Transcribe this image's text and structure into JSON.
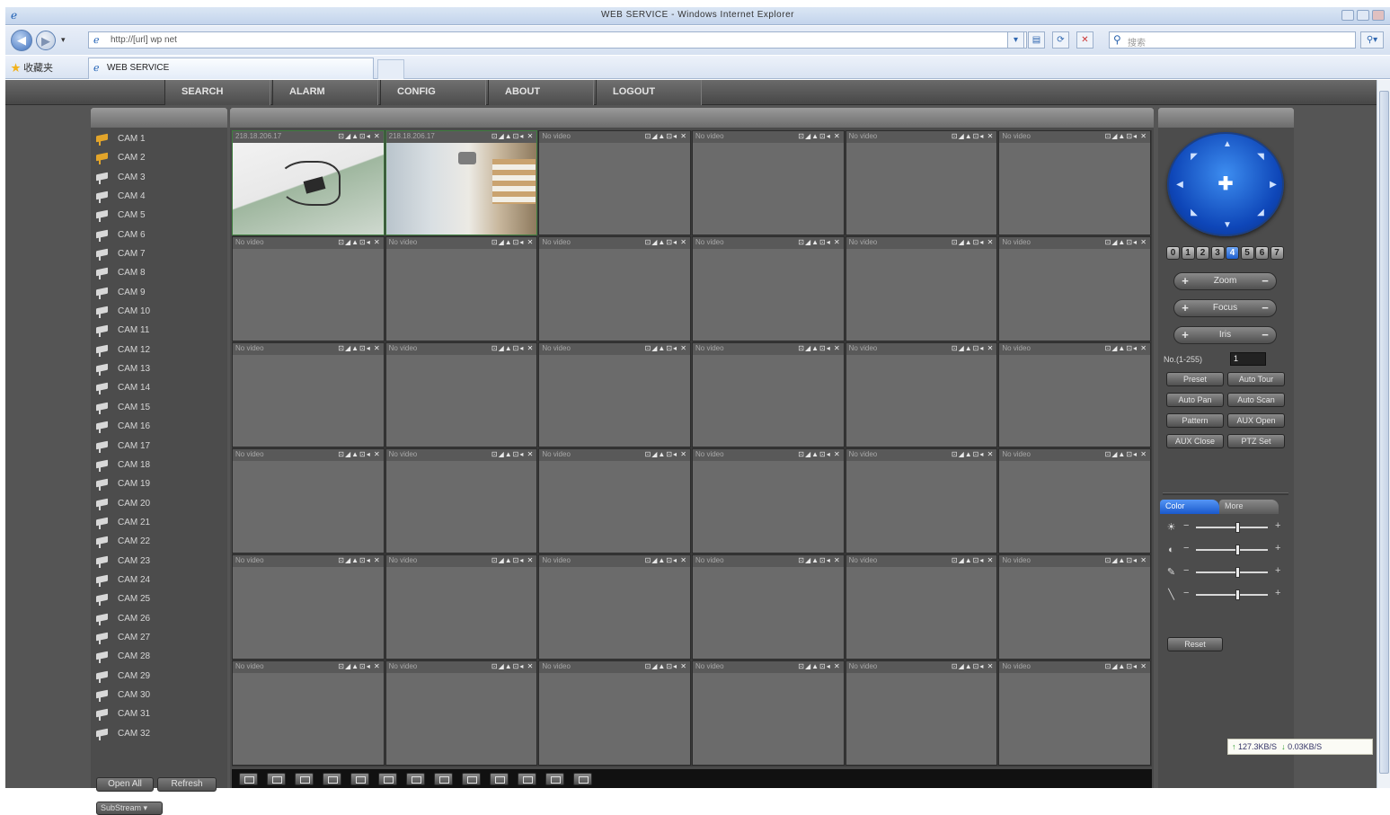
{
  "browser": {
    "title": "WEB SERVICE - Windows Internet Explorer",
    "address": "http://[url] wp net",
    "search_placeholder": "搜索",
    "favorites_label": "收藏夹",
    "tab_label": "WEB SERVICE"
  },
  "menu": [
    "SEARCH",
    "ALARM",
    "CONFIG",
    "ABOUT",
    "LOGOUT"
  ],
  "cameras": [
    "CAM 1",
    "CAM 2",
    "CAM 3",
    "CAM 4",
    "CAM 5",
    "CAM 6",
    "CAM 7",
    "CAM 8",
    "CAM 9",
    "CAM 10",
    "CAM 11",
    "CAM 12",
    "CAM 13",
    "CAM 14",
    "CAM 15",
    "CAM 16",
    "CAM 17",
    "CAM 18",
    "CAM 19",
    "CAM 20",
    "CAM 21",
    "CAM 22",
    "CAM 23",
    "CAM 24",
    "CAM 25",
    "CAM 26",
    "CAM 27",
    "CAM 28",
    "CAM 29",
    "CAM 30",
    "CAM 31",
    "CAM 32"
  ],
  "active_cameras": [
    1,
    2
  ],
  "left_buttons": {
    "open_all": "Open All",
    "refresh": "Refresh",
    "stream": "SubStream"
  },
  "video": {
    "live_labels": [
      "218.18.206.17",
      "218.18.206.17"
    ],
    "no_video": "No video",
    "controls_glyphs": "⊡◢▲⊡◂ ✕"
  },
  "ptz": {
    "speeds": [
      "0",
      "1",
      "2",
      "3",
      "4",
      "5",
      "6",
      "7"
    ],
    "selected_speed": "4",
    "zoom": "Zoom",
    "focus": "Focus",
    "iris": "Iris",
    "no_label": "No.(1-255)",
    "no_value": "1",
    "buttons": [
      "Preset",
      "Auto Tour",
      "Auto Pan",
      "Auto Scan",
      "Pattern",
      "AUX Open",
      "AUX Close",
      "PTZ Set"
    ],
    "tab_color": "Color",
    "tab_more": "More",
    "reset": "Reset"
  },
  "status": {
    "up": "127.3KB/S",
    "down": "0.03KB/S"
  },
  "colors": {
    "accent": "#1a59cc",
    "page_bg": "#555555",
    "active_cam": "#e3a52a"
  }
}
